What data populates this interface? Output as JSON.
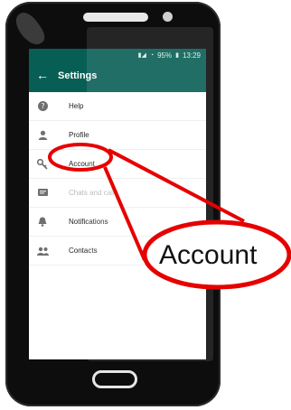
{
  "status_bar": {
    "battery": "95%",
    "time": "13:29"
  },
  "appbar": {
    "back_icon": "back-arrow-icon",
    "title": "Settings"
  },
  "menu": [
    {
      "icon": "help-icon",
      "label": "Help"
    },
    {
      "icon": "profile-icon",
      "label": "Profile"
    },
    {
      "icon": "key-icon",
      "label": "Account"
    },
    {
      "icon": "chat-icon",
      "label": "Chats and calls"
    },
    {
      "icon": "bell-icon",
      "label": "Notifications"
    },
    {
      "icon": "contacts-icon",
      "label": "Contacts"
    }
  ],
  "callout": {
    "label": "Account",
    "color": "#e60000"
  },
  "colors": {
    "appbar": "#075e54",
    "phone_body": "#0d0d0d"
  }
}
